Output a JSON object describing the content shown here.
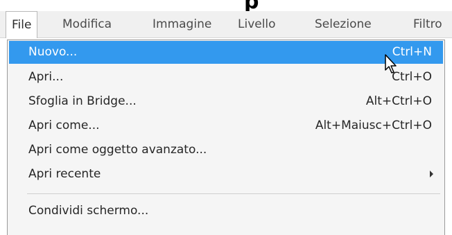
{
  "menubar": {
    "items": [
      {
        "label": "File",
        "active": true
      },
      {
        "label": "Modifica"
      },
      {
        "label": "Immagine"
      },
      {
        "label": "Livello"
      },
      {
        "label": "Selezione"
      },
      {
        "label": "Filtro"
      }
    ]
  },
  "file_menu": {
    "items": [
      {
        "label": "Nuovo...",
        "shortcut": "Ctrl+N",
        "highlighted": true
      },
      {
        "label": "Apri...",
        "shortcut": "Ctrl+O"
      },
      {
        "label": "Sfoglia in Bridge...",
        "shortcut": "Alt+Ctrl+O"
      },
      {
        "label": "Apri come...",
        "shortcut": "Alt+Maiusc+Ctrl+O"
      },
      {
        "label": "Apri come oggetto avanzato...",
        "shortcut": ""
      },
      {
        "label": "Apri recente",
        "shortcut": "",
        "submenu": true
      },
      {
        "label": "Condividi schermo...",
        "shortcut": ""
      }
    ]
  },
  "colors": {
    "highlight": "#3399ee",
    "menubar_bg": "#f0f0f0",
    "menu_bg": "#f5f5f5"
  },
  "icons": {
    "cursor": "mouse-pointer-icon",
    "submenu": "chevron-right-icon"
  }
}
